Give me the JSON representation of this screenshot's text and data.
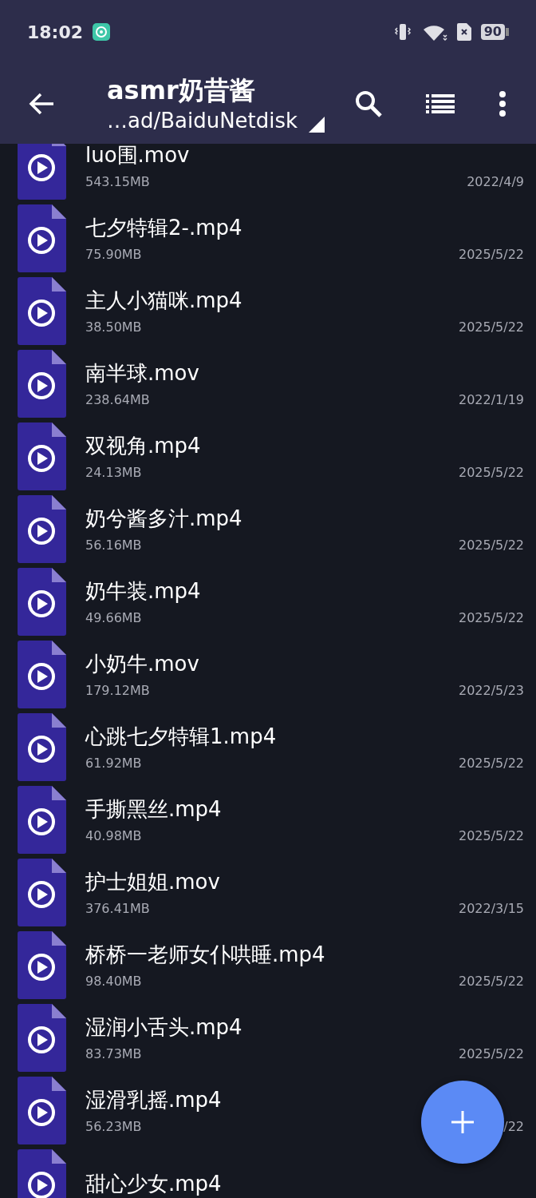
{
  "status_bar": {
    "time": "18:02",
    "battery": "90"
  },
  "toolbar": {
    "title": "asmr奶昔酱",
    "path": "…ad/BaiduNetdisk"
  },
  "files": [
    {
      "name": "luo围.mov",
      "size": "543.15MB",
      "date": "2022/4/9"
    },
    {
      "name": "七夕特辑2-.mp4",
      "size": "75.90MB",
      "date": "2025/5/22"
    },
    {
      "name": "主人小猫咪.mp4",
      "size": "38.50MB",
      "date": "2025/5/22"
    },
    {
      "name": "南半球.mov",
      "size": "238.64MB",
      "date": "2022/1/19"
    },
    {
      "name": "双视角.mp4",
      "size": "24.13MB",
      "date": "2025/5/22"
    },
    {
      "name": "奶兮酱多汁.mp4",
      "size": "56.16MB",
      "date": "2025/5/22"
    },
    {
      "name": "奶牛装.mp4",
      "size": "49.66MB",
      "date": "2025/5/22"
    },
    {
      "name": "小奶牛.mov",
      "size": "179.12MB",
      "date": "2022/5/23"
    },
    {
      "name": "心跳七夕特辑1.mp4",
      "size": "61.92MB",
      "date": "2025/5/22"
    },
    {
      "name": "手撕黑丝.mp4",
      "size": "40.98MB",
      "date": "2025/5/22"
    },
    {
      "name": "护士姐姐.mov",
      "size": "376.41MB",
      "date": "2022/3/15"
    },
    {
      "name": "桥桥一老师女仆哄睡.mp4",
      "size": "98.40MB",
      "date": "2025/5/22"
    },
    {
      "name": "湿润小舌头.mp4",
      "size": "83.73MB",
      "date": "2025/5/22"
    },
    {
      "name": "湿滑乳摇.mp4",
      "size": "56.23MB",
      "date": "/22"
    },
    {
      "name": "甜心少女.mp4"
    }
  ]
}
